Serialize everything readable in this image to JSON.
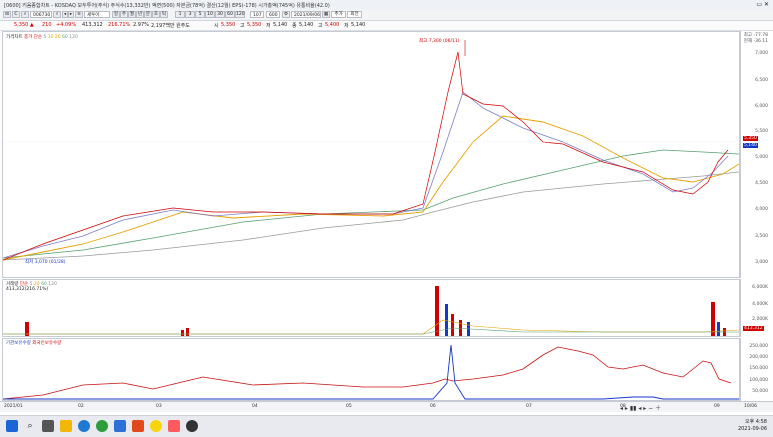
{
  "window": {
    "title": "[0600] 키움종합차트 - KOSDAQ 모두투어(주식) 주식수(13,332만) 액면(500) 자본금(78억) 결산(12월) EPS(-178) 시가총액(745억) 유통비율(42.0)"
  },
  "toolbar": {
    "code": "006730",
    "name": "세투어",
    "period_buttons": [
      "일",
      "주",
      "월",
      "년",
      "분",
      "초",
      "틱"
    ],
    "interval_buttons": [
      "1",
      "3",
      "5",
      "10",
      "30",
      "60",
      "120"
    ],
    "count": "107",
    "value_field": "600",
    "date": "2021/09/06",
    "end_buttons": [
      "추가",
      "회전"
    ]
  },
  "price_row": {
    "current": "5,350 ▲",
    "change": "210",
    "change_pct": "+4.09%",
    "volume": "413,312",
    "vol_ratio": "216.71%",
    "rate2": "2.97%",
    "amount": "2,197백만 원주도",
    "open_label": "시",
    "open": "5,350",
    "high_label": "고",
    "high": "5,350",
    "low_label": "저",
    "low": "5,140",
    "close_label": "종",
    "close": "5,140",
    "extra_label": "고",
    "extra": "5,400",
    "extra2_label": "저",
    "extra2": "5,140"
  },
  "price_panel": {
    "legend_title": "가격차트",
    "legend_items": [
      "종가",
      "단순",
      "5",
      "10",
      "20",
      "60",
      "120"
    ],
    "annotation_high": "최고 7,300 (06/11)",
    "annotation_low": "최저 3,070 (01/28)",
    "axis_top_label": "최고 -77.78",
    "axis_top_label2": "현재 -36.11",
    "axis_labels": [
      "7,000",
      "6,500",
      "6,000",
      "5,500",
      "5,000",
      "4,500",
      "4,000",
      "3,500",
      "3,000"
    ],
    "current_tag": "5,350",
    "current_tag2": "5,140"
  },
  "volume_panel": {
    "legend_title": "거래량",
    "legend_items": [
      "단순",
      "5",
      "20",
      "60",
      "120"
    ],
    "legend_value": "413,312(216.71%)",
    "axis_labels": [
      "6,000K",
      "4,000K",
      "2,000K"
    ],
    "current_tag": "413,312"
  },
  "flow_panel": {
    "legend_title": "기관보유수량",
    "legend_item": "외국인보유수량",
    "axis_labels": [
      "250,000",
      "200,000",
      "150,000",
      "100,000",
      "50,000"
    ]
  },
  "date_axis": {
    "labels": [
      "2021/01",
      "02",
      "03",
      "04",
      "05",
      "06",
      "07",
      "08",
      "09"
    ],
    "right_label": "10/06"
  },
  "taskbar": {
    "time": "오후 4:58",
    "date": "2021-09-06"
  },
  "colors": {
    "up": "#d10000",
    "down": "#1537c8",
    "ma5": "#7c7ccc",
    "ma10": "#e1a800",
    "ma20": "#e6a000",
    "ma60": "#55a070",
    "ma120": "#888888"
  }
}
